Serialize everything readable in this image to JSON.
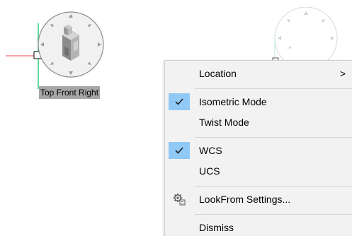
{
  "viewcube": {
    "label": "Top Front Right",
    "icon": "isometric-house-icon"
  },
  "context_menu": {
    "items": [
      {
        "label": "Location",
        "arrow": ">",
        "type": "submenu"
      },
      {
        "label": "Isometric Mode",
        "checked": true,
        "type": "check"
      },
      {
        "label": "Twist Mode",
        "checked": false,
        "type": "check"
      },
      {
        "label": "WCS",
        "checked": true,
        "type": "check"
      },
      {
        "label": "UCS",
        "checked": false,
        "type": "check"
      },
      {
        "label": "LookFrom Settings...",
        "icon": "settings-gear-icon",
        "type": "action"
      },
      {
        "label": "Dismiss",
        "type": "action"
      }
    ]
  },
  "colors": {
    "menu_bg": "#f2f2f2",
    "check_highlight": "#90c8f6",
    "axis_x": "#e8474c",
    "axis_y": "#2ad07a",
    "label_bg": "#a6a6a6"
  }
}
